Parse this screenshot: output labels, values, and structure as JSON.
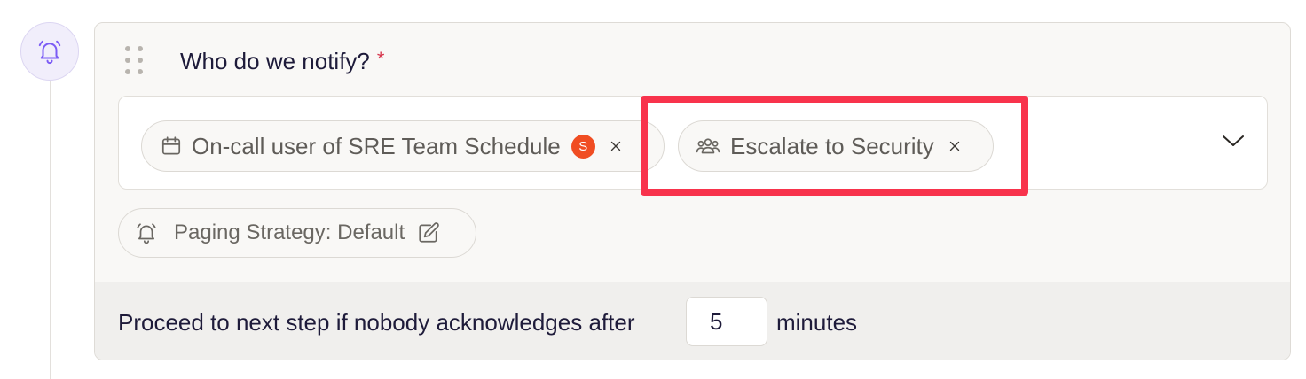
{
  "step": {
    "question": "Who do we notify?",
    "required_mark": "*",
    "targets": [
      {
        "icon": "calendar-icon",
        "label": "On-call user of SRE Team Schedule",
        "avatar_initial": "S",
        "avatar_color": "#f04d22"
      },
      {
        "icon": "users-icon",
        "label": "Escalate to Security"
      }
    ],
    "paging_strategy": {
      "icon": "bell-icon",
      "label": "Paging Strategy: Default"
    },
    "proceed": {
      "prefix": "Proceed to next step if nobody acknowledges after",
      "value": "5",
      "suffix": "minutes"
    }
  },
  "colors": {
    "highlight": "#f8334c",
    "accent": "#7c5cf5",
    "required": "#d6334a"
  }
}
